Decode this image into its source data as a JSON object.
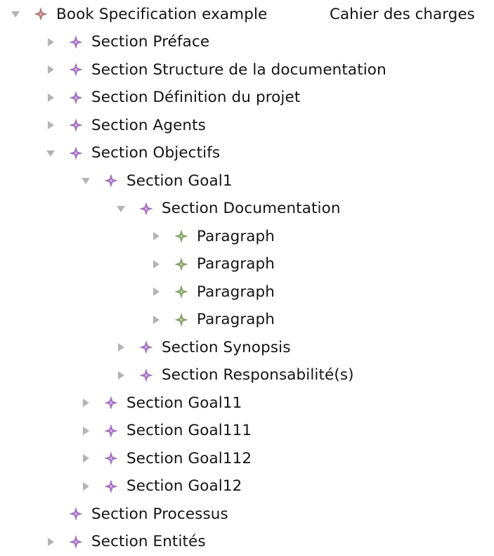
{
  "colors": {
    "root_icon": "#b5787a",
    "section_icon": "#a574c2",
    "paragraph_icon": "#88a36a",
    "triangle": "#b4b4b4",
    "text": "#141414"
  },
  "tree": [
    {
      "label": "Book Specification example",
      "extra": "Cahier des charges",
      "depth": 0,
      "state": "expanded",
      "kind": "root",
      "icon": "star-icon"
    },
    {
      "label": "Section Préface",
      "depth": 1,
      "state": "collapsed",
      "kind": "section",
      "icon": "star-icon"
    },
    {
      "label": "Section Structure de la documentation",
      "depth": 1,
      "state": "collapsed",
      "kind": "section",
      "icon": "star-icon"
    },
    {
      "label": "Section Définition du projet",
      "depth": 1,
      "state": "collapsed",
      "kind": "section",
      "icon": "star-icon"
    },
    {
      "label": "Section Agents",
      "depth": 1,
      "state": "collapsed",
      "kind": "section",
      "icon": "star-icon"
    },
    {
      "label": "Section Objectifs",
      "depth": 1,
      "state": "expanded",
      "kind": "section",
      "icon": "star-icon"
    },
    {
      "label": "Section Goal1",
      "depth": 2,
      "state": "expanded",
      "kind": "section",
      "icon": "star-icon"
    },
    {
      "label": "Section Documentation",
      "depth": 3,
      "state": "expanded",
      "kind": "section",
      "icon": "star-icon"
    },
    {
      "label": "Paragraph",
      "depth": 4,
      "state": "collapsed",
      "kind": "paragraph",
      "icon": "star-icon"
    },
    {
      "label": "Paragraph",
      "depth": 4,
      "state": "collapsed",
      "kind": "paragraph",
      "icon": "star-icon"
    },
    {
      "label": "Paragraph",
      "depth": 4,
      "state": "collapsed",
      "kind": "paragraph",
      "icon": "star-icon"
    },
    {
      "label": "Paragraph",
      "depth": 4,
      "state": "collapsed",
      "kind": "paragraph",
      "icon": "star-icon"
    },
    {
      "label": "Section Synopsis",
      "depth": 3,
      "state": "collapsed",
      "kind": "section",
      "icon": "star-icon"
    },
    {
      "label": "Section Responsabilité(s)",
      "depth": 3,
      "state": "collapsed",
      "kind": "section",
      "icon": "star-icon"
    },
    {
      "label": "Section Goal11",
      "depth": 2,
      "state": "collapsed",
      "kind": "section",
      "icon": "star-icon"
    },
    {
      "label": "Section Goal111",
      "depth": 2,
      "state": "collapsed",
      "kind": "section",
      "icon": "star-icon"
    },
    {
      "label": "Section Goal112",
      "depth": 2,
      "state": "collapsed",
      "kind": "section",
      "icon": "star-icon"
    },
    {
      "label": "Section Goal12",
      "depth": 2,
      "state": "collapsed",
      "kind": "section",
      "icon": "star-icon"
    },
    {
      "label": "Section Processus",
      "depth": 1,
      "state": "leaf",
      "kind": "section",
      "icon": "star-icon"
    },
    {
      "label": "Section Entités",
      "depth": 1,
      "state": "collapsed",
      "kind": "section",
      "icon": "star-icon"
    }
  ]
}
